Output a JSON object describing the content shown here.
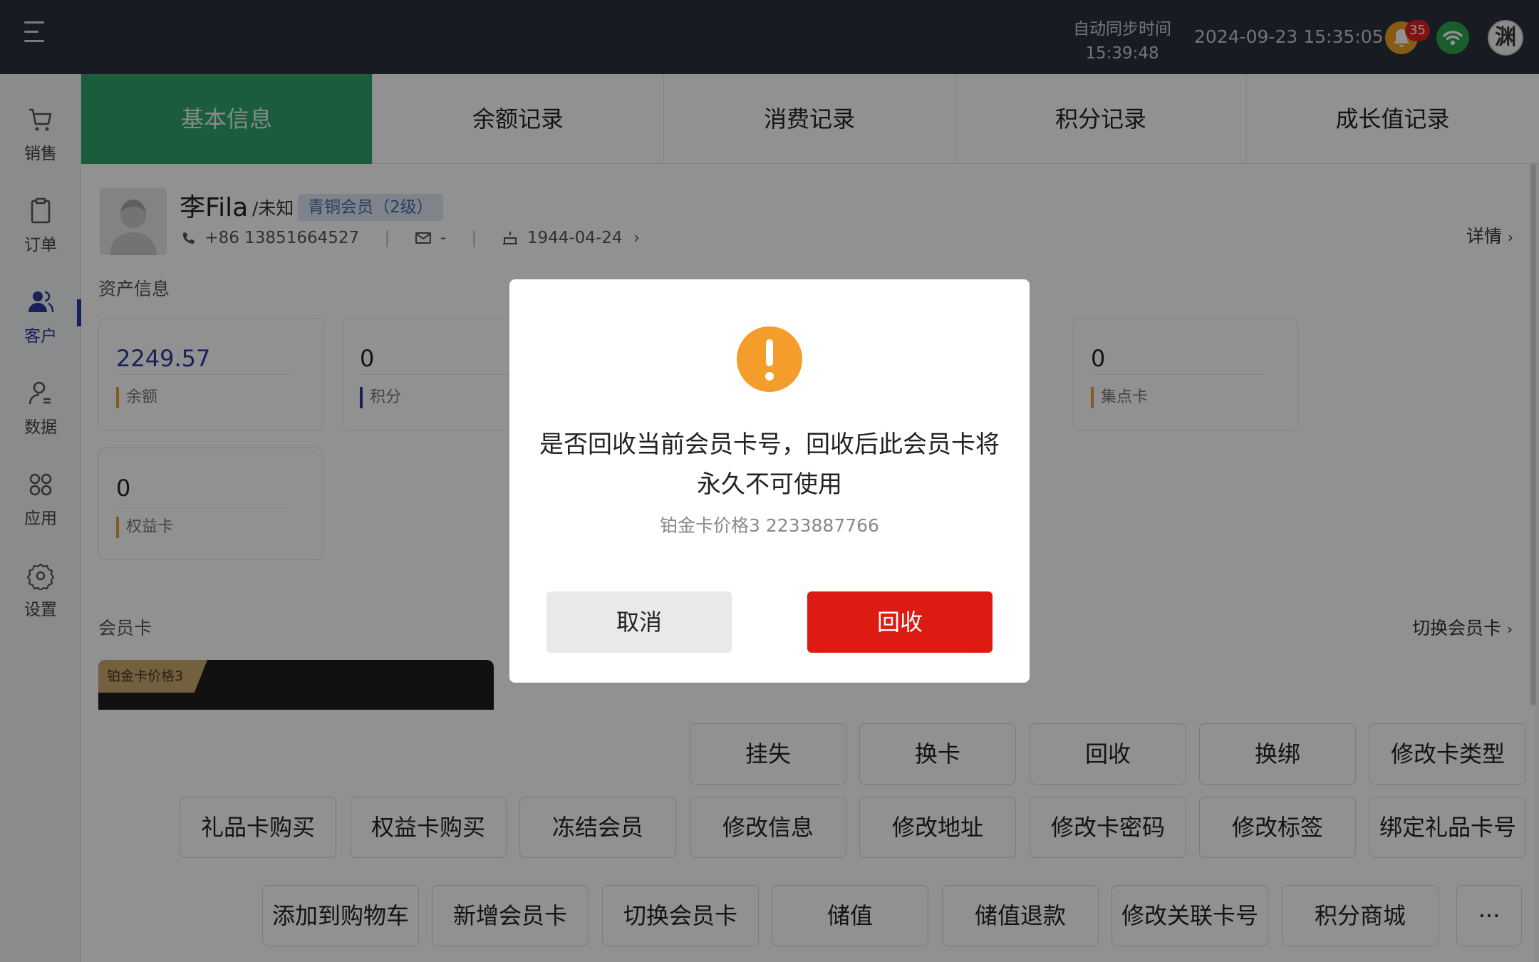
{
  "topbar": {
    "sync_label": "自动同步时间",
    "sync_time": "15:39:48",
    "datetime": "2024-09-23 15:35:05",
    "notification_count": "35",
    "avatar_text": "渊",
    "colors": {
      "bg": "#2b303b",
      "bell": "#f0a020",
      "wifi": "#2ea44f",
      "badge": "#e02020"
    }
  },
  "sidebar": {
    "items": [
      {
        "label": "销售",
        "icon": "cart-icon"
      },
      {
        "label": "订单",
        "icon": "clipboard-icon"
      },
      {
        "label": "客户",
        "icon": "customers-icon",
        "active": true
      },
      {
        "label": "数据",
        "icon": "user-data-icon"
      },
      {
        "label": "应用",
        "icon": "apps-grid-icon"
      },
      {
        "label": "设置",
        "icon": "gear-icon"
      }
    ]
  },
  "tabs": [
    {
      "label": "基本信息",
      "active": true
    },
    {
      "label": "余额记录"
    },
    {
      "label": "消费记录"
    },
    {
      "label": "积分记录"
    },
    {
      "label": "成长值记录"
    }
  ],
  "member": {
    "name": "李Fila",
    "gender": "/未知",
    "level": "青铜会员（2级）",
    "phone": "+86 13851664527",
    "email": "-",
    "birthday": "1944-04-24",
    "detail_link": "详情"
  },
  "assets": {
    "title": "资产信息",
    "cards": [
      {
        "value": "2249.57",
        "label": "余额"
      },
      {
        "value": "0",
        "label": "积分"
      },
      {
        "value": "0",
        "label": "集点卡"
      },
      {
        "value": "0",
        "label": "权益卡"
      }
    ]
  },
  "membership": {
    "title": "会员卡",
    "switch_link": "切换会员卡",
    "card_name": "铂金卡价格3"
  },
  "actions": {
    "row1": [
      "挂失",
      "换卡",
      "回收",
      "换绑",
      "修改卡类型"
    ],
    "row2": [
      "礼品卡购买",
      "权益卡购买",
      "冻结会员",
      "修改信息",
      "修改地址",
      "修改卡密码",
      "修改标签",
      "绑定礼品卡号"
    ],
    "row3": [
      "添加到购物车",
      "新增会员卡",
      "切换会员卡",
      "储值",
      "储值退款",
      "修改关联卡号",
      "积分商城",
      "···"
    ]
  },
  "dialog": {
    "message_line1": "是否回收当前会员卡号，回收后此会员卡将",
    "message_line2": "永久不可使用",
    "sub": "铂金卡价格3 2233887766",
    "cancel": "取消",
    "confirm": "回收",
    "colors": {
      "warn": "#f59d2a",
      "confirm": "#de1b13"
    }
  }
}
